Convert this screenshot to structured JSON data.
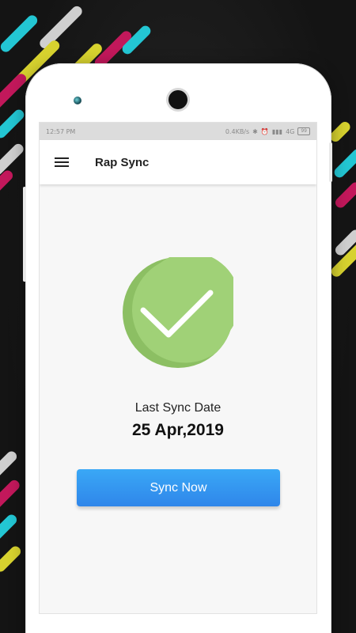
{
  "status_bar": {
    "time": "12:57 PM",
    "network_speed": "0.4KB/s",
    "network_type": "4G",
    "battery_level": "99"
  },
  "app_bar": {
    "title": "Rap Sync",
    "menu_icon": "hamburger-menu-icon"
  },
  "sync_status": {
    "status_icon": "check-circle-icon",
    "label": "Last Sync Date",
    "date": "25 Apr,2019"
  },
  "actions": {
    "sync_button_label": "Sync Now"
  },
  "colors": {
    "check_circle": "#a0d177",
    "check_circle_shade": "#8cbf63",
    "button_top": "#3aa8f6",
    "button_bottom": "#2f86ea",
    "stripe_cyan": "#23c6d3",
    "stripe_yellow": "#d7d22f",
    "stripe_magenta": "#c2185b",
    "stripe_grey": "#cfcfcf"
  }
}
